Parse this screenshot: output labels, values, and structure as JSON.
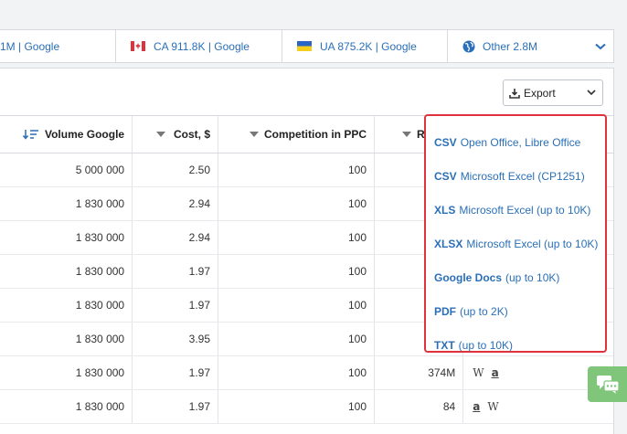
{
  "regions": [
    {
      "label": "1M | Google",
      "flag": "none"
    },
    {
      "label": "CA 911.8K | Google",
      "flag": "canada"
    },
    {
      "label": "UA 875.2K | Google",
      "flag": "ukraine"
    },
    {
      "label": "Other 2.8M",
      "flag": "globe-icon"
    }
  ],
  "toolbar": {
    "export_label": "Export"
  },
  "table": {
    "headers": [
      "Volume Google",
      "Cost, $",
      "Competition in PPC",
      "R"
    ],
    "rows": [
      {
        "volume": "5 000 000",
        "cost": "2.50",
        "competition": "100",
        "r": "",
        "sources": []
      },
      {
        "volume": "1 830 000",
        "cost": "2.94",
        "competition": "100",
        "r": "",
        "sources": []
      },
      {
        "volume": "1 830 000",
        "cost": "2.94",
        "competition": "100",
        "r": "",
        "sources": []
      },
      {
        "volume": "1 830 000",
        "cost": "1.97",
        "competition": "100",
        "r": "",
        "sources": []
      },
      {
        "volume": "1 830 000",
        "cost": "1.97",
        "competition": "100",
        "r": "",
        "sources": []
      },
      {
        "volume": "1 830 000",
        "cost": "3.95",
        "competition": "100",
        "r": "",
        "sources": []
      },
      {
        "volume": "1 830 000",
        "cost": "1.97",
        "competition": "100",
        "r": "374M",
        "sources": [
          "W",
          "a"
        ]
      },
      {
        "volume": "1 830 000",
        "cost": "1.97",
        "competition": "100",
        "r": "84",
        "sources": [
          "a",
          "W"
        ]
      }
    ]
  },
  "export_menu": [
    {
      "format": "CSV",
      "desc": "Open Office, Libre Office"
    },
    {
      "format": "CSV",
      "desc": "Microsoft Excel (CP1251)"
    },
    {
      "format": "XLS",
      "desc": "Microsoft Excel (up to 10K)"
    },
    {
      "format": "XLSX",
      "desc": "Microsoft Excel (up to 10K)"
    },
    {
      "format": "Google Docs",
      "desc": "(up to 10K)"
    },
    {
      "format": "PDF",
      "desc": "(up to 2K)"
    },
    {
      "format": "TXT",
      "desc": "(up to 10K)"
    }
  ],
  "colors": {
    "accent": "#2a6fb7",
    "dropdown_border": "#e0323c",
    "chat": "#7fc67a"
  }
}
